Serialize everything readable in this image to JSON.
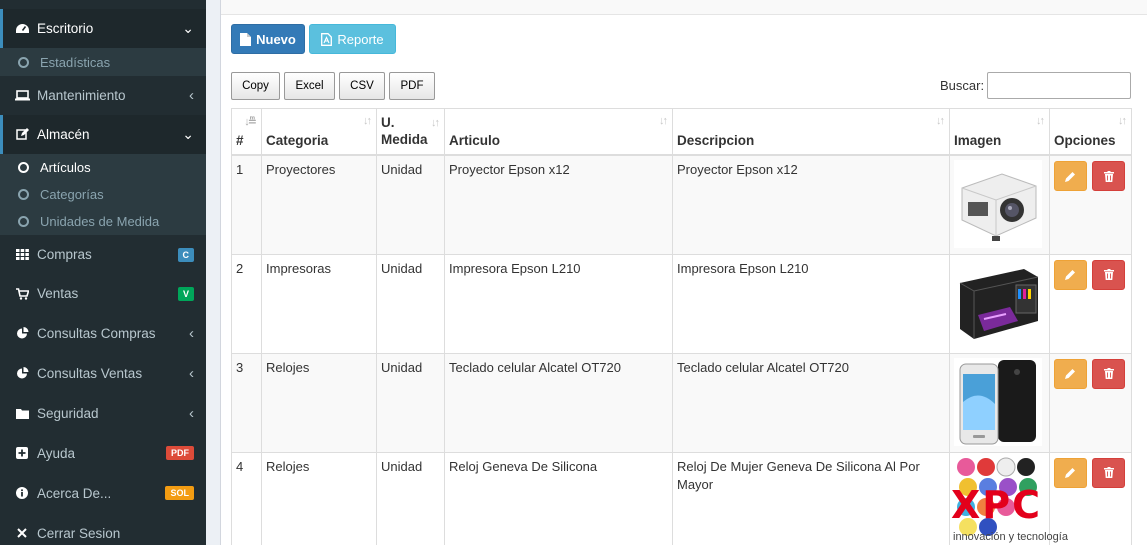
{
  "sidebar": {
    "escritorio": {
      "label": "Escritorio",
      "icon": "dashboard-icon",
      "arrow": "⌄"
    },
    "estadisticas": {
      "label": "Estadísticas"
    },
    "mantenimiento": {
      "label": "Mantenimiento",
      "icon": "laptop-icon",
      "arrow": "‹"
    },
    "almacen": {
      "label": "Almacén",
      "icon": "edit-icon",
      "arrow": "⌄"
    },
    "articulos": {
      "label": "Artículos"
    },
    "categorias": {
      "label": "Categorías"
    },
    "unidades": {
      "label": "Unidades de Medida"
    },
    "compras": {
      "label": "Compras",
      "badge": "C",
      "badge_color": "#3c8dbc"
    },
    "ventas": {
      "label": "Ventas",
      "badge": "V",
      "badge_color": "#00a65a"
    },
    "consultas_compras": {
      "label": "Consultas Compras",
      "arrow": "‹"
    },
    "consultas_ventas": {
      "label": "Consultas Ventas",
      "arrow": "‹"
    },
    "seguridad": {
      "label": "Seguridad",
      "arrow": "‹"
    },
    "ayuda": {
      "label": "Ayuda",
      "badge": "PDF",
      "badge_color": "#dd4b39"
    },
    "acerca": {
      "label": "Acerca De...",
      "badge": "SOL",
      "badge_color": "#f39c12"
    },
    "cerrar": {
      "label": "Cerrar Sesion"
    }
  },
  "toolbar": {
    "nuevo_label": "Nuevo",
    "reporte_label": "Reporte",
    "copy_label": "Copy",
    "excel_label": "Excel",
    "csv_label": "CSV",
    "pdf_label": "PDF",
    "search_label": "Buscar:",
    "search_value": ""
  },
  "table": {
    "headers": {
      "num": "#",
      "categoria": "Categoria",
      "medida_1": "U.",
      "medida_2": "Medida",
      "articulo": "Articulo",
      "descripcion": "Descripcion",
      "imagen": "Imagen",
      "opciones": "Opciones"
    },
    "rows": [
      {
        "num": "1",
        "categoria": "Proyectores",
        "medida": "Unidad",
        "articulo": "Proyector Epson x12",
        "descripcion": "Proyector Epson x12",
        "image": "projector"
      },
      {
        "num": "2",
        "categoria": "Impresoras",
        "medida": "Unidad",
        "articulo": "Impresora Epson L210",
        "descripcion": "Impresora Epson L210",
        "image": "printer"
      },
      {
        "num": "3",
        "categoria": "Relojes",
        "medida": "Unidad",
        "articulo": "Teclado celular Alcatel OT720",
        "descripcion": "Teclado celular Alcatel OT720",
        "image": "phones"
      },
      {
        "num": "4",
        "categoria": "Relojes",
        "medida": "Unidad",
        "articulo": "Reloj Geneva De Silicona",
        "descripcion": "Reloj De Mujer Geneva De Silicona Al Por Mayor",
        "image": "watches"
      }
    ]
  },
  "watermark": {
    "logo": "XPC",
    "subtitle": "innovación y tecnología"
  }
}
